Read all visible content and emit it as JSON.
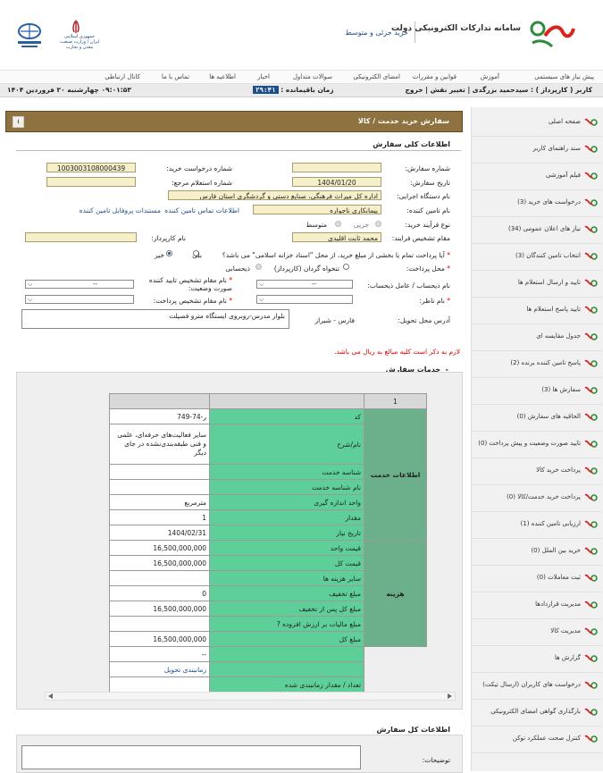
{
  "header": {
    "app_title": "سامانه تدارکات الکترونیکی دولت",
    "app_subtitle": "خرید جزئی و متوسط",
    "ministry": "جمهوری اسلامی ایران / وزارت صنعت، معدن و تجارت",
    "logo_brand": "ستاد"
  },
  "menu": [
    "پیش نیاز های سیستمی",
    "آموزش",
    "قوانین و مقررات",
    "امضای الکترونیکی",
    "سوالات متداول",
    "اخبار",
    "اطلاعیه ها",
    "تماس با ما",
    "کانال ارتباطی"
  ],
  "userbar": {
    "user": "کاربر ( کارپرداز ) : سیدحمید بزرگدی | تغییر نقش | خروج",
    "session_label": "زمان باقیمانده :",
    "session_time": "۲۹:۴۱",
    "datetime": "۰۹:۰۱:۵۳ چهارشنبه ۲۰ فروردین ۱۴۰۴"
  },
  "sidebar": {
    "items": [
      {
        "label": "صفحه اصلی"
      },
      {
        "label": "سند راهنمای کاربر"
      },
      {
        "label": "فیلم آموزشی"
      },
      {
        "label": "درخواست های خرید (3)"
      },
      {
        "label": "نیاز های اعلان عمومی (34)"
      },
      {
        "label": "انتخاب تامین کنندگان (3)"
      },
      {
        "label": "تایید و ارسال استعلام ها"
      },
      {
        "label": "تایید پاسخ استعلام ها"
      },
      {
        "label": "جدول مقایسه ای"
      },
      {
        "label": "پاسخ تامین کننده برنده (2)"
      },
      {
        "label": "سفارش ها (3)"
      },
      {
        "label": "الحاقیه های سفارش (0)"
      },
      {
        "label": "تایید صورت وضعیت و پیش پرداخت (0)"
      },
      {
        "label": "پرداخت خرید کالا"
      },
      {
        "label": "پرداخت خرید خدمت/کالا (0)"
      },
      {
        "label": "ارزیابی تامین کننده (1)"
      },
      {
        "label": "خرید بین الملل (0)"
      },
      {
        "label": "ثبت معاملات (0)"
      },
      {
        "label": "مدیریت قراردادها"
      },
      {
        "label": "مدیریت کالا"
      },
      {
        "label": "گزارش ها"
      },
      {
        "label": "درخواست های کاربران (ارسال تیکت)"
      },
      {
        "label": "بارگذاری گواهی امضای الکترونیکی"
      },
      {
        "label": "کنترل صحت عملکرد توکن"
      }
    ]
  },
  "page": {
    "title": "سفارش خرید خدمت / کالا",
    "general_section": "اطلاعات کلی سفارش"
  },
  "form": {
    "order_no_label": "شماره سفارش:",
    "order_no": "",
    "request_no_label": "شماره درخواست خرید:",
    "request_no": "1003003108000439",
    "order_date_label": "تاریخ سفارش:",
    "order_date": "1404/01/20",
    "ref_inquiry_label": "شماره استعلام مرجع:",
    "ref_inquiry": "",
    "executive_label": "نام دستگاه اجرایی:",
    "executive": "اداره کل میراث فرهنگی، صنایع دستی و گردشگری استان فارس",
    "supplier_label": "نام تامین کننده:",
    "supplier": "پیمانکاری ناجواره",
    "supplier_contact_link": "اطلاعات تماس تامین کننده",
    "supplier_docs_link": "مستندات پروفایل تامین کننده",
    "process_type_label": "نوع فرآیند خرید:",
    "process_minor": "جزیی",
    "process_medium": "متوسط",
    "determiner_label": "مقام تشخیص فرایند:",
    "determiner": "محمد ثابت اقلیدی",
    "agent_name_label": "نام کارپرداز:",
    "agent_name": "",
    "treasury_label": "آیا پرداخت تمام یا بخشی از مبلغ خرید، از محل \"اسناد خزانه اسلامی\" می باشد؟",
    "yes": "بلی",
    "no": "خیر",
    "payment_source_label": "محل پرداخت:",
    "payment_revolving": "تنخواه گردان (کارپرداز)",
    "payment_beneficiary": "ذیحسابی",
    "beneficiary_label": "نام ذیحساب / عامل ذیحساب:",
    "beneficiary_value": "--",
    "approver_label": "نام مقام تشخیص تایید کننده صورت وضعیت:",
    "approver_value": "--",
    "supervisor_label": "نام ناظر:",
    "supervisor_value": "",
    "payment_authority_label": "نام مقام تشخیص پرداخت:",
    "payment_authority_value": "",
    "delivery_label": "آدرس محل تحویل:",
    "delivery_city": "فارس - شیراز",
    "delivery_address": "بلوار مدرس-روبروی ایستگاه مترو فصیلت",
    "notice": "لازم به ذکر است کلیه مبالغ به ریال می باشد."
  },
  "services": {
    "section_title": "خدمات سفارش",
    "column_header": "1",
    "group_info": "اطلاعات خدمت",
    "group_cost": "هزینه",
    "info_rows": [
      {
        "label": "کد",
        "value": "ر-74-749"
      },
      {
        "label": "نام/شرح",
        "value": "سایر فعالیت‌های حرفه‌ای، علمی و فنی طبقه‌بندی‌نشده در جای دیگر"
      },
      {
        "label": "شناسه خدمت",
        "value": ""
      },
      {
        "label": "نام شناسه خدمت",
        "value": ""
      },
      {
        "label": "واحد اندازه گیری",
        "value": "مترمربع"
      },
      {
        "label": "مقدار",
        "value": "1"
      },
      {
        "label": "تاریخ نیاز",
        "value": "1404/02/31"
      }
    ],
    "cost_rows": [
      {
        "label": "قیمت واحد",
        "value": "16,500,000,000"
      },
      {
        "label": "قیمت کل",
        "value": "16,500,000,000"
      },
      {
        "label": "سایر هزینه ها",
        "value": ""
      },
      {
        "label": "مبلغ تخفیف",
        "value": "0"
      },
      {
        "label": "مبلغ کل پس از تخفیف",
        "value": "16,500,000,000"
      },
      {
        "label": "مبلغ مالیات بر ارزش افزوده ?",
        "value": ""
      },
      {
        "label": "مبلغ کل",
        "value": "16,500,000,000"
      }
    ],
    "extra_rows": [
      {
        "label": "",
        "value": "--"
      },
      {
        "label": "",
        "value": "زمانبندی تحویل",
        "link": true
      },
      {
        "label": "تعداد / مقدار زمانبندی شده",
        "value": ""
      }
    ]
  },
  "totals": {
    "section_title": "اطلاعات کل سفارش",
    "notes_label": "توضیحات:"
  },
  "colors": {
    "header_bar": "#8e7240",
    "table_green": "#5fcf9a",
    "group_green": "#6bb08a",
    "link_blue": "#1d4e88",
    "notice_red": "#dd0000",
    "field_bg": "#f5f0c9"
  },
  "icons": [
    "setad-logo",
    "iran-emblem",
    "industry-ministry-seal",
    "sidebar-arrow-icon",
    "download-icon",
    "dropdown-arrow-icon"
  ]
}
